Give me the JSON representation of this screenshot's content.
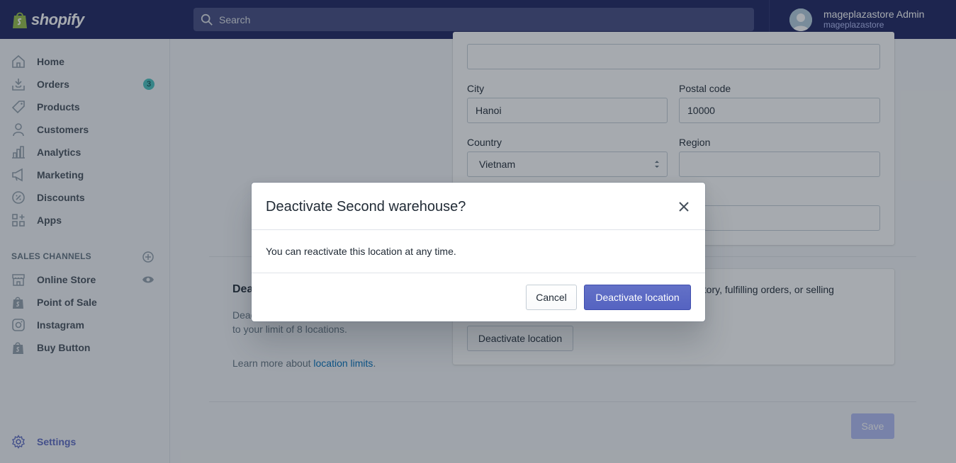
{
  "brand": {
    "name": "shopify"
  },
  "search": {
    "placeholder": "Search"
  },
  "user": {
    "name": "mageplazastore Admin",
    "store": "mageplazastore"
  },
  "sidebar": {
    "items": [
      {
        "label": "Home",
        "icon": "home-icon"
      },
      {
        "label": "Orders",
        "icon": "orders-icon",
        "badge": "3"
      },
      {
        "label": "Products",
        "icon": "tag-icon"
      },
      {
        "label": "Customers",
        "icon": "person-icon"
      },
      {
        "label": "Analytics",
        "icon": "bar-chart-icon"
      },
      {
        "label": "Marketing",
        "icon": "megaphone-icon"
      },
      {
        "label": "Discounts",
        "icon": "discount-icon"
      },
      {
        "label": "Apps",
        "icon": "apps-icon"
      }
    ],
    "sales_channels_title": "SALES CHANNELS",
    "channels": [
      {
        "label": "Online Store",
        "icon": "store-icon"
      },
      {
        "label": "Point of Sale",
        "icon": "shopify-bag-icon"
      },
      {
        "label": "Instagram",
        "icon": "instagram-icon"
      },
      {
        "label": "Buy Button",
        "icon": "shopify-bag-icon"
      }
    ],
    "settings_label": "Settings"
  },
  "form": {
    "address2_value": "",
    "city_label": "City",
    "city_value": "Hanoi",
    "postal_label": "Postal code",
    "postal_value": "10000",
    "country_label": "Country",
    "country_value": "Vietnam",
    "region_label": "Region",
    "region_value": "",
    "phone_value": ""
  },
  "deactivate_section": {
    "title": "Deac",
    "desc_line1": "Deac",
    "desc_line2": "to your limit of 8 locations.",
    "learn_prefix": "Learn more about ",
    "learn_link": "location limits",
    "learn_suffix": ".",
    "card_text": "ntory, fulfilling orders, or selling",
    "button_label": "Deactivate location"
  },
  "save_label": "Save",
  "modal": {
    "title": "Deactivate Second warehouse?",
    "body": "You can reactivate this location at any time.",
    "cancel_label": "Cancel",
    "confirm_label": "Deactivate location"
  },
  "colors": {
    "topbar": "#1c2260",
    "primary": "#5c6ac4",
    "badge": "#47c1bf",
    "link": "#006fbb"
  }
}
